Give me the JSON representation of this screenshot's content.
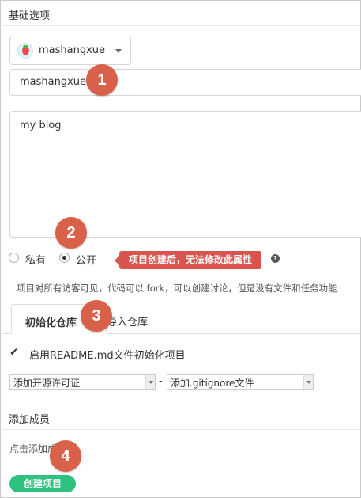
{
  "basic": {
    "title": "基础选项"
  },
  "owner": {
    "name": "mashangxue",
    "avatar_icon": "strawberry-avatar"
  },
  "repo_name": {
    "value": "mashangxue"
  },
  "description": {
    "value": "my blog"
  },
  "visibility": {
    "private_label": "私有",
    "public_label": "公开",
    "selected": "public",
    "tooltip": "项目创建后，无法修改此属性",
    "help_icon": "?",
    "hint": "项目对所有访客可见，代码可以 fork，可以创建讨论，但是没有文件和任务功能"
  },
  "tabs": {
    "init": "初始化仓库",
    "import": "导入仓库"
  },
  "init": {
    "readme_label": "启用README.md文件初始化项目",
    "readme_checked": true,
    "license_select": "添加开源许可证",
    "separator": "-",
    "gitignore_select": "添加.gitignore文件"
  },
  "members": {
    "title": "添加成员",
    "hint": "点击添加成员"
  },
  "actions": {
    "create": "创建项目"
  },
  "callouts": {
    "one": "1",
    "two": "2",
    "three": "3",
    "four": "4"
  },
  "colors": {
    "primary_button": "#2ec27e",
    "tooltip": "#d9534f",
    "callout": "#d9614a"
  }
}
